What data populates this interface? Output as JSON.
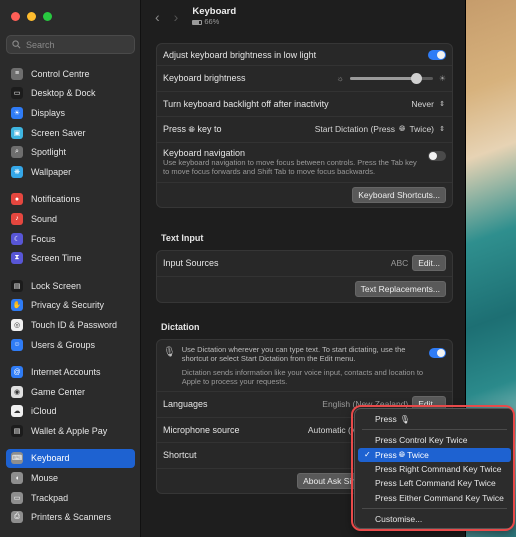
{
  "window": {
    "title": "Keyboard",
    "battery": "66%"
  },
  "search": {
    "placeholder": "Search"
  },
  "sidebar": {
    "items": [
      {
        "label": "Control Centre",
        "icon": "control-centre-icon",
        "color": "#6e6e6e"
      },
      {
        "label": "Desktop & Dock",
        "icon": "dock-icon",
        "color": "#1c1c1c"
      },
      {
        "label": "Displays",
        "icon": "displays-icon",
        "color": "#2f7cf6"
      },
      {
        "label": "Screen Saver",
        "icon": "screen-saver-icon",
        "color": "#3fb5e0"
      },
      {
        "label": "Spotlight",
        "icon": "spotlight-icon",
        "color": "#6e6e6e"
      },
      {
        "label": "Wallpaper",
        "icon": "wallpaper-icon",
        "color": "#35a7e8"
      },
      {
        "label": "Notifications",
        "icon": "notifications-icon",
        "color": "#e5473f"
      },
      {
        "label": "Sound",
        "icon": "sound-icon",
        "color": "#e5473f"
      },
      {
        "label": "Focus",
        "icon": "focus-icon",
        "color": "#5856d6"
      },
      {
        "label": "Screen Time",
        "icon": "screen-time-icon",
        "color": "#5856d6"
      },
      {
        "label": "Lock Screen",
        "icon": "lock-screen-icon",
        "color": "#1c1c1c"
      },
      {
        "label": "Privacy & Security",
        "icon": "privacy-icon",
        "color": "#2f7cf6"
      },
      {
        "label": "Touch ID & Password",
        "icon": "touch-id-icon",
        "color": "#f0f0f0"
      },
      {
        "label": "Users & Groups",
        "icon": "users-icon",
        "color": "#2f7cf6"
      },
      {
        "label": "Internet Accounts",
        "icon": "internet-accounts-icon",
        "color": "#2f7cf6"
      },
      {
        "label": "Game Center",
        "icon": "game-center-icon",
        "color": "#e0e0e0"
      },
      {
        "label": "iCloud",
        "icon": "icloud-icon",
        "color": "#f0f0f0"
      },
      {
        "label": "Wallet & Apple Pay",
        "icon": "wallet-icon",
        "color": "#1c1c1c"
      },
      {
        "label": "Keyboard",
        "icon": "keyboard-icon",
        "color": "#8e8e8e"
      },
      {
        "label": "Mouse",
        "icon": "mouse-icon",
        "color": "#8e8e8e"
      },
      {
        "label": "Trackpad",
        "icon": "trackpad-icon",
        "color": "#8e8e8e"
      },
      {
        "label": "Printers & Scanners",
        "icon": "printers-icon",
        "color": "#8e8e8e"
      }
    ]
  },
  "keyboard_group": {
    "adjust_brightness_label": "Adjust keyboard brightness in low light",
    "brightness_label": "Keyboard brightness",
    "brightness_level": 0.8,
    "backlight_off_label": "Turn keyboard backlight off after inactivity",
    "backlight_off_value": "Never",
    "press_key_label_pre": "Press",
    "press_key_label_post": "key to",
    "press_key_value_pre": "Start Dictation (Press",
    "press_key_value_post": "Twice)",
    "nav_label": "Keyboard navigation",
    "nav_desc": "Use keyboard navigation to move focus between controls. Press the Tab key to move focus forwards and Shift Tab to move focus backwards.",
    "shortcuts_button": "Keyboard Shortcuts..."
  },
  "text_input": {
    "section_title": "Text Input",
    "input_sources_label": "Input Sources",
    "input_sources_value": "ABC",
    "edit_button": "Edit...",
    "replacements_button": "Text Replacements..."
  },
  "dictation": {
    "section_title": "Dictation",
    "desc1": "Use Dictation wherever you can type text. To start dictating, use the shortcut or select Start Dictation from the Edit menu.",
    "desc2": "Dictation sends information like your voice input, contacts and location to Apple to process your requests.",
    "languages_label": "Languages",
    "languages_value": "English (New Zealand)",
    "edit_button": "Edit...",
    "mic_label": "Microphone source",
    "mic_value": "Automatic (MacBoo",
    "shortcut_label": "Shortcut",
    "about_button": "About Ask Siri"
  },
  "popup_menu": {
    "items": [
      {
        "label": "Press",
        "suffix_icon": "microphone-icon"
      },
      {
        "label": "Press Control Key Twice"
      },
      {
        "label_pre": "Press",
        "label_post": "Twice",
        "selected": true
      },
      {
        "label": "Press Right Command Key Twice"
      },
      {
        "label": "Press Left Command Key Twice"
      },
      {
        "label": "Press Either Command Key Twice"
      },
      {
        "label": "Customise..."
      }
    ],
    "highlight_color": "#e84a4a"
  }
}
